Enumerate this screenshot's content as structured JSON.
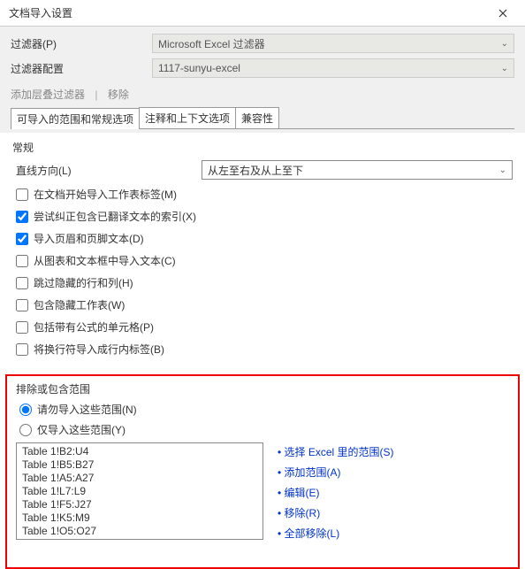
{
  "window": {
    "title": "文档导入设置"
  },
  "filter": {
    "label": "过滤器(P)",
    "value": "Microsoft Excel 过滤器"
  },
  "filterConfig": {
    "label": "过滤器配置",
    "value": "1117-sunyu-excel"
  },
  "links": {
    "add": "添加层叠过滤器",
    "remove": "移除"
  },
  "tabs": {
    "t1": "可导入的范围和常规选项",
    "t2": "注释和上下文选项",
    "t3": "兼容性"
  },
  "general": {
    "title": "常规",
    "directionLabel": "直线方向(L)",
    "directionValue": "从左至右及从上至下"
  },
  "checkboxes": {
    "c1": "在文档开始导入工作表标签(M)",
    "c2": "尝试纠正包含已翻译文本的索引(X)",
    "c3": "导入页眉和页脚文本(D)",
    "c4": "从图表和文本框中导入文本(C)",
    "c5": "跳过隐藏的行和列(H)",
    "c6": "包含隐藏工作表(W)",
    "c7": "包括带有公式的单元格(P)",
    "c8": "将换行符导入成行内标签(B)"
  },
  "rangeSection": {
    "title": "排除或包含范围",
    "radio1": "请勿导入这些范围(N)",
    "radio2": "仅导入这些范围(Y)"
  },
  "ranges": {
    "r0": "Table 1!B2:U4",
    "r1": "Table 1!B5:B27",
    "r2": "Table 1!A5:A27",
    "r3": "Table 1!L7:L9",
    "r4": "Table 1!F5:J27",
    "r5": "Table 1!K5:M9",
    "r6": "Table 1!O5:O27"
  },
  "actions": {
    "a1": "选择 Excel 里的范围(S)",
    "a2": "添加范围(A)",
    "a3": "编辑(E)",
    "a4": "移除(R)",
    "a5": "全部移除(L)"
  }
}
